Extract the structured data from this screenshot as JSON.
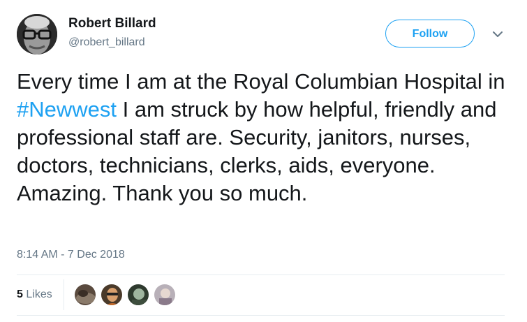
{
  "author": {
    "display_name": "Robert Billard",
    "handle": "@robert_billard",
    "avatar_icon": "profile-photo"
  },
  "actions": {
    "follow_label": "Follow",
    "menu_icon": "chevron-down-icon"
  },
  "tweet": {
    "text_before_hashtag": "Every time I am at the Royal Columbian Hospital in ",
    "hashtag": "#Newwest",
    "text_after_hashtag": " I am struck by how helpful, friendly and professional staff are. Security, janitors, nurses, doctors, technicians, clerks, aids, everyone. Amazing. Thank you so much.",
    "timestamp": "8:14 AM - 7 Dec 2018"
  },
  "stats": {
    "likes_count": "5",
    "likes_label": "Likes"
  },
  "colors": {
    "accent": "#1da1f2",
    "text": "#14171a",
    "muted": "#657786",
    "divider": "#e6ecf0"
  }
}
